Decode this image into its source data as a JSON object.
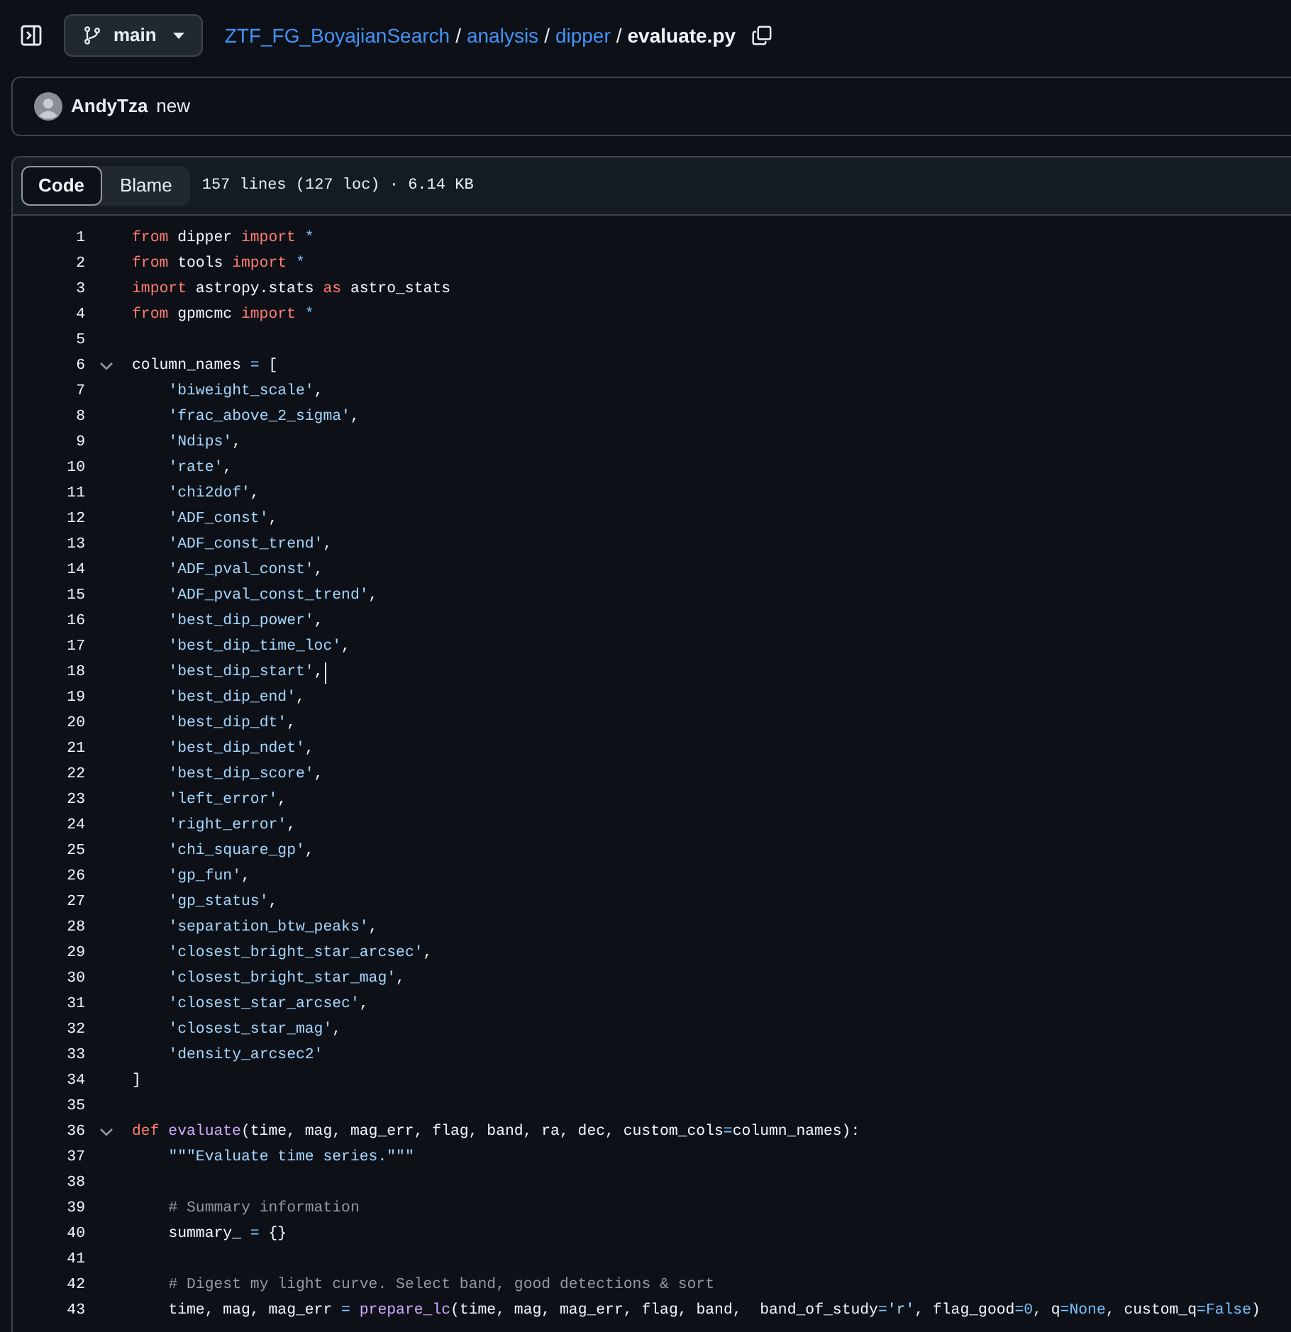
{
  "branch": {
    "label": "main"
  },
  "breadcrumb": [
    {
      "label": "ZTF_FG_BoyajianSearch",
      "kind": "link"
    },
    {
      "label": "/",
      "kind": "separator"
    },
    {
      "label": "analysis",
      "kind": "link"
    },
    {
      "label": "/",
      "kind": "separator"
    },
    {
      "label": "dipper",
      "kind": "link"
    },
    {
      "label": "/",
      "kind": "separator"
    },
    {
      "label": "evaluate.py",
      "kind": "current"
    }
  ],
  "commit": {
    "author": "AndyTza",
    "message": "new"
  },
  "tabs": [
    {
      "label": "Code",
      "selected": true
    },
    {
      "label": "Blame",
      "selected": false
    }
  ],
  "file_info": "157 lines (127 loc) · 6.14 KB",
  "lines": [
    {
      "number": "1",
      "tokens": [
        {
          "kind": "keyword",
          "text": "from"
        },
        {
          "kind": "plain",
          "text": " dipper "
        },
        {
          "kind": "keyword",
          "text": "import"
        },
        {
          "kind": "operator",
          "text": " *"
        }
      ]
    },
    {
      "number": "2",
      "tokens": [
        {
          "kind": "keyword",
          "text": "from"
        },
        {
          "kind": "plain",
          "text": " tools "
        },
        {
          "kind": "keyword",
          "text": "import"
        },
        {
          "kind": "operator",
          "text": " *"
        }
      ]
    },
    {
      "number": "3",
      "tokens": [
        {
          "kind": "keyword",
          "text": "import"
        },
        {
          "kind": "plain",
          "text": " astropy.stats "
        },
        {
          "kind": "keyword",
          "text": "as"
        },
        {
          "kind": "plain",
          "text": " astro_stats"
        }
      ]
    },
    {
      "number": "4",
      "tokens": [
        {
          "kind": "keyword",
          "text": "from"
        },
        {
          "kind": "plain",
          "text": " gpmcmc "
        },
        {
          "kind": "keyword",
          "text": "import"
        },
        {
          "kind": "operator",
          "text": " *"
        }
      ]
    },
    {
      "number": "5"
    },
    {
      "number": "6",
      "fold": {
        "expanded": true
      },
      "tokens": [
        {
          "kind": "plain",
          "text": "column_names "
        },
        {
          "kind": "operator",
          "text": "="
        },
        {
          "kind": "plain",
          "text": " ["
        }
      ]
    },
    {
      "number": "7",
      "indented": true,
      "tokens": [
        {
          "kind": "string",
          "text": "'biweight_scale'"
        },
        {
          "kind": "plain",
          "text": ","
        }
      ]
    },
    {
      "number": "8",
      "indented": true,
      "tokens": [
        {
          "kind": "string",
          "text": "'frac_above_2_sigma'"
        },
        {
          "kind": "plain",
          "text": ","
        }
      ]
    },
    {
      "number": "9",
      "indented": true,
      "tokens": [
        {
          "kind": "string",
          "text": "'Ndips'"
        },
        {
          "kind": "plain",
          "text": ","
        }
      ]
    },
    {
      "number": "10",
      "indented": true,
      "tokens": [
        {
          "kind": "string",
          "text": "'rate'"
        },
        {
          "kind": "plain",
          "text": ","
        }
      ]
    },
    {
      "number": "11",
      "indented": true,
      "tokens": [
        {
          "kind": "string",
          "text": "'chi2dof'"
        },
        {
          "kind": "plain",
          "text": ","
        }
      ]
    },
    {
      "number": "12",
      "indented": true,
      "tokens": [
        {
          "kind": "string",
          "text": "'ADF_const'"
        },
        {
          "kind": "plain",
          "text": ","
        }
      ]
    },
    {
      "number": "13",
      "indented": true,
      "tokens": [
        {
          "kind": "string",
          "text": "'ADF_const_trend'"
        },
        {
          "kind": "plain",
          "text": ","
        }
      ]
    },
    {
      "number": "14",
      "indented": true,
      "tokens": [
        {
          "kind": "string",
          "text": "'ADF_pval_const'"
        },
        {
          "kind": "plain",
          "text": ","
        }
      ]
    },
    {
      "number": "15",
      "indented": true,
      "tokens": [
        {
          "kind": "string",
          "text": "'ADF_pval_const_trend'"
        },
        {
          "kind": "plain",
          "text": ","
        }
      ]
    },
    {
      "number": "16",
      "indented": true,
      "tokens": [
        {
          "kind": "string",
          "text": "'best_dip_power'"
        },
        {
          "kind": "plain",
          "text": ","
        }
      ]
    },
    {
      "number": "17",
      "indented": true,
      "tokens": [
        {
          "kind": "string",
          "text": "'best_dip_time_loc'"
        },
        {
          "kind": "plain",
          "text": ","
        }
      ]
    },
    {
      "number": "18",
      "indented": true,
      "cursor": true,
      "tokens": [
        {
          "kind": "string",
          "text": "'best_dip_start'"
        },
        {
          "kind": "plain",
          "text": ","
        }
      ]
    },
    {
      "number": "19",
      "indented": true,
      "tokens": [
        {
          "kind": "string",
          "text": "'best_dip_end'"
        },
        {
          "kind": "plain",
          "text": ","
        }
      ]
    },
    {
      "number": "20",
      "indented": true,
      "tokens": [
        {
          "kind": "string",
          "text": "'best_dip_dt'"
        },
        {
          "kind": "plain",
          "text": ","
        }
      ]
    },
    {
      "number": "21",
      "indented": true,
      "tokens": [
        {
          "kind": "string",
          "text": "'best_dip_ndet'"
        },
        {
          "kind": "plain",
          "text": ","
        }
      ]
    },
    {
      "number": "22",
      "indented": true,
      "tokens": [
        {
          "kind": "string",
          "text": "'best_dip_score'"
        },
        {
          "kind": "plain",
          "text": ","
        }
      ]
    },
    {
      "number": "23",
      "indented": true,
      "tokens": [
        {
          "kind": "string",
          "text": "'left_error'"
        },
        {
          "kind": "plain",
          "text": ","
        }
      ]
    },
    {
      "number": "24",
      "indented": true,
      "tokens": [
        {
          "kind": "string",
          "text": "'right_error'"
        },
        {
          "kind": "plain",
          "text": ","
        }
      ]
    },
    {
      "number": "25",
      "indented": true,
      "tokens": [
        {
          "kind": "string",
          "text": "'chi_square_gp'"
        },
        {
          "kind": "plain",
          "text": ","
        }
      ]
    },
    {
      "number": "26",
      "indented": true,
      "tokens": [
        {
          "kind": "string",
          "text": "'gp_fun'"
        },
        {
          "kind": "plain",
          "text": ","
        }
      ]
    },
    {
      "number": "27",
      "indented": true,
      "tokens": [
        {
          "kind": "string",
          "text": "'gp_status'"
        },
        {
          "kind": "plain",
          "text": ","
        }
      ]
    },
    {
      "number": "28",
      "indented": true,
      "tokens": [
        {
          "kind": "string",
          "text": "'separation_btw_peaks'"
        },
        {
          "kind": "plain",
          "text": ","
        }
      ]
    },
    {
      "number": "29",
      "indented": true,
      "tokens": [
        {
          "kind": "string",
          "text": "'closest_bright_star_arcsec'"
        },
        {
          "kind": "plain",
          "text": ","
        }
      ]
    },
    {
      "number": "30",
      "indented": true,
      "tokens": [
        {
          "kind": "string",
          "text": "'closest_bright_star_mag'"
        },
        {
          "kind": "plain",
          "text": ","
        }
      ]
    },
    {
      "number": "31",
      "indented": true,
      "tokens": [
        {
          "kind": "string",
          "text": "'closest_star_arcsec'"
        },
        {
          "kind": "plain",
          "text": ","
        }
      ]
    },
    {
      "number": "32",
      "indented": true,
      "tokens": [
        {
          "kind": "string",
          "text": "'closest_star_mag'"
        },
        {
          "kind": "plain",
          "text": ","
        }
      ]
    },
    {
      "number": "33",
      "indented": true,
      "tokens": [
        {
          "kind": "string",
          "text": "'density_arcsec2'"
        }
      ]
    },
    {
      "number": "34",
      "tokens": [
        {
          "kind": "plain",
          "text": "]"
        }
      ]
    },
    {
      "number": "35"
    },
    {
      "number": "36",
      "fold": {
        "expanded": true
      },
      "tokens": [
        {
          "kind": "keyword",
          "text": "def"
        },
        {
          "kind": "function",
          "text": " evaluate"
        },
        {
          "kind": "plain",
          "text": "(time, mag, mag_err, flag, band, ra, dec, custom_cols"
        },
        {
          "kind": "operator",
          "text": "="
        },
        {
          "kind": "plain",
          "text": "column_names):"
        }
      ]
    },
    {
      "number": "37",
      "indented": true,
      "tokens": [
        {
          "kind": "string",
          "text": "\"\"\"Evaluate time series.\"\"\""
        }
      ]
    },
    {
      "number": "38"
    },
    {
      "number": "39",
      "indented": true,
      "tokens": [
        {
          "kind": "comment",
          "text": "# Summary information"
        }
      ]
    },
    {
      "number": "40",
      "indented": true,
      "tokens": [
        {
          "kind": "plain",
          "text": "summary_ "
        },
        {
          "kind": "operator",
          "text": "="
        },
        {
          "kind": "plain",
          "text": " {}"
        }
      ]
    },
    {
      "number": "41"
    },
    {
      "number": "42",
      "indented": true,
      "tokens": [
        {
          "kind": "comment",
          "text": "# Digest my light curve. Select band, good detections & sort"
        }
      ]
    },
    {
      "number": "43",
      "indented": true,
      "tokens": [
        {
          "kind": "plain",
          "text": "time, mag, mag_err "
        },
        {
          "kind": "operator",
          "text": "="
        },
        {
          "kind": "function",
          "text": " prepare_lc"
        },
        {
          "kind": "plain",
          "text": "(time, mag, mag_err, flag, band,  band_of_study"
        },
        {
          "kind": "operator",
          "text": "="
        },
        {
          "kind": "string",
          "text": "'r'"
        },
        {
          "kind": "plain",
          "text": ", flag_good"
        },
        {
          "kind": "operator",
          "text": "="
        },
        {
          "kind": "operator",
          "text": "0"
        },
        {
          "kind": "plain",
          "text": ", q"
        },
        {
          "kind": "operator",
          "text": "="
        },
        {
          "kind": "operator",
          "text": "None"
        },
        {
          "kind": "plain",
          "text": ", custom_q"
        },
        {
          "kind": "operator",
          "text": "="
        },
        {
          "kind": "operator",
          "text": "False"
        },
        {
          "kind": "plain",
          "text": ")"
        }
      ]
    }
  ]
}
